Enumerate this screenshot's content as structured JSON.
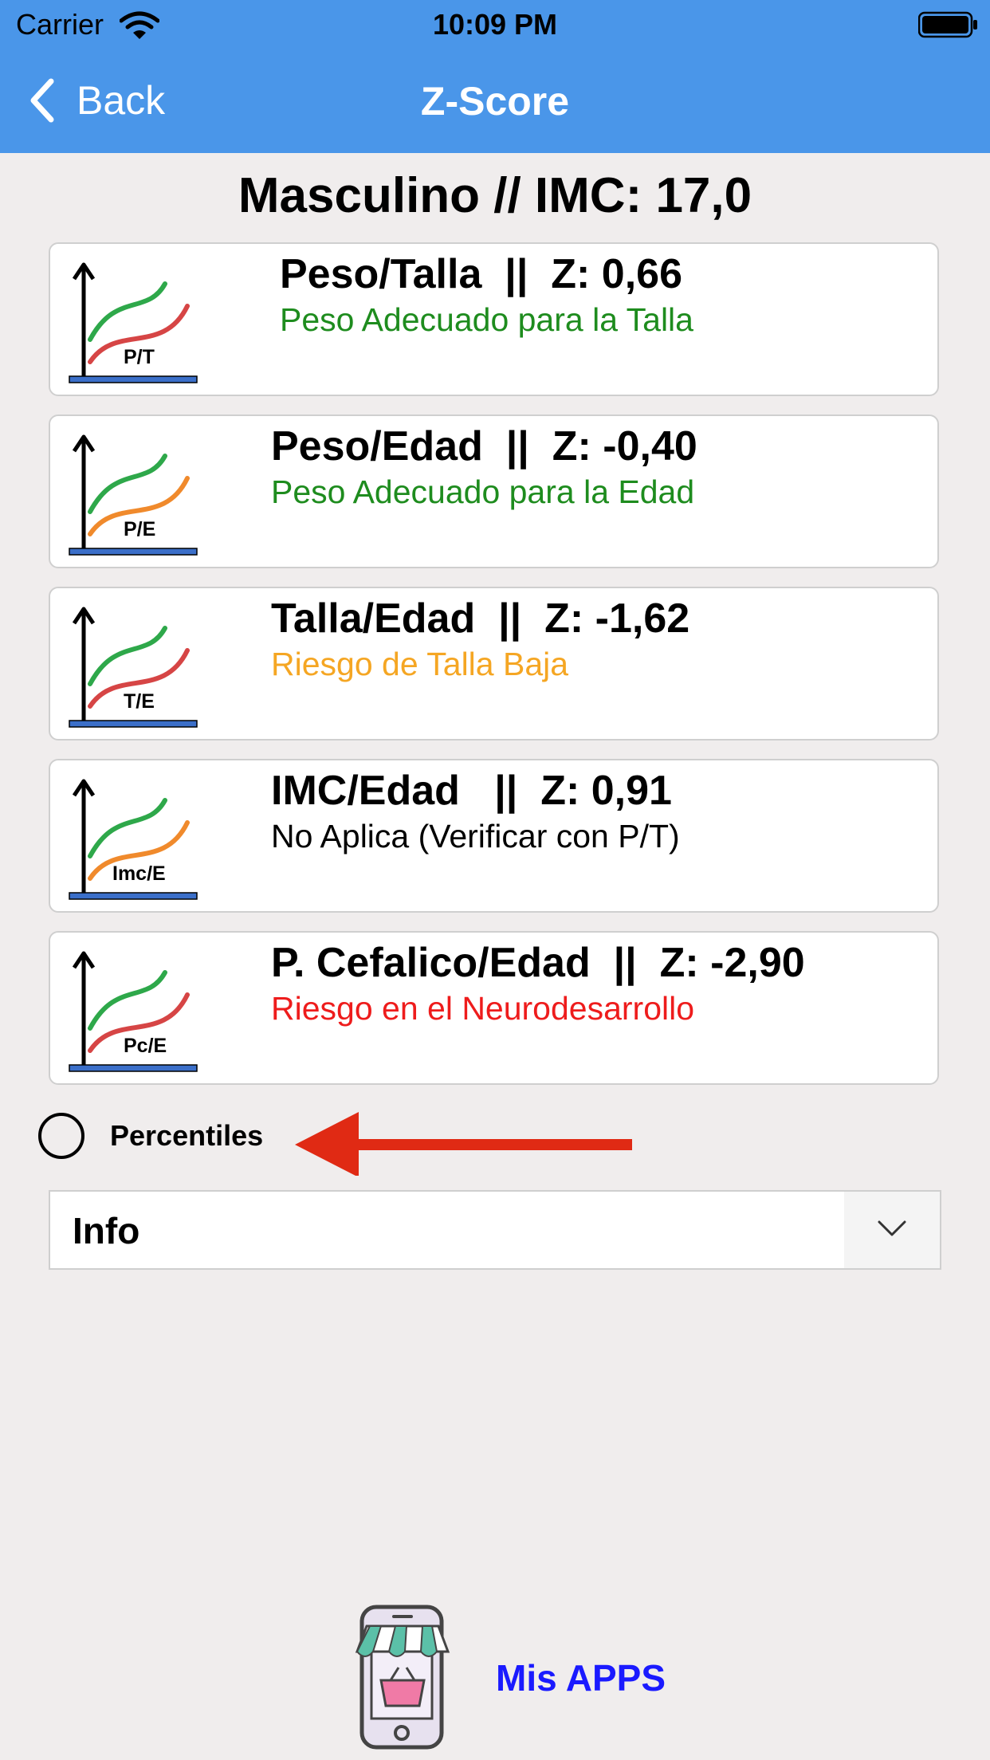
{
  "status_bar": {
    "carrier": "Carrier",
    "time": "10:09 PM"
  },
  "nav": {
    "back_label": "Back",
    "title": "Z-Score"
  },
  "summary": "Masculino // IMC: 17,0",
  "cards": [
    {
      "icon_label": "P/T",
      "title": "Peso/Talla  ||  Z: 0,66",
      "status": "Peso Adecuado para la Talla",
      "status_color": "#1e8c1e",
      "curve_color": "#d64545"
    },
    {
      "icon_label": "P/E",
      "title": "Peso/Edad  ||  Z: -0,40",
      "status": "Peso Adecuado para la Edad",
      "status_color": "#1e8c1e",
      "curve_color": "#f08a2c"
    },
    {
      "icon_label": "T/E",
      "title": "Talla/Edad  ||  Z: -1,62",
      "status": "Riesgo de Talla Baja",
      "status_color": "#f5a623",
      "curve_color": "#d64545"
    },
    {
      "icon_label": "Imc/E",
      "title": "IMC/Edad   ||  Z: 0,91",
      "status": "No Aplica (Verificar con P/T)",
      "status_color": "#000000",
      "curve_color": "#f08a2c"
    },
    {
      "icon_label": "Pc/E",
      "title": "P. Cefalico/Edad  ||  Z: -2,90",
      "status": "Riesgo en el Neurodesarrollo",
      "status_color": "#ee1c1c",
      "curve_color": "#d64545"
    }
  ],
  "percentiles": {
    "label": "Percentiles",
    "checked": false
  },
  "info": {
    "label": "Info"
  },
  "apps": {
    "label": "Mis APPS"
  },
  "colors": {
    "nav_bar": "#4a96e9",
    "background": "#f0eded",
    "annotation_arrow": "#e02a14",
    "link": "#1a1aff"
  },
  "icons": [
    "wifi-icon",
    "battery-icon",
    "chevron-left-icon",
    "growth-chart-icon",
    "arrow-annotation-icon",
    "chevron-down-icon",
    "app-store-icon"
  ]
}
